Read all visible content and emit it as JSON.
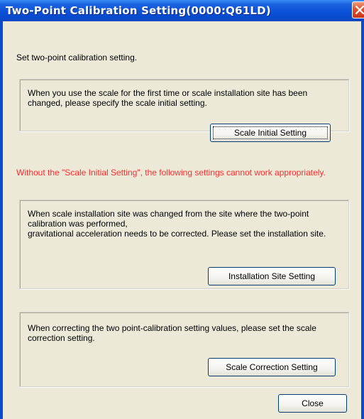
{
  "window": {
    "title": "Two-Point Calibration Setting(0000:Q61LD)"
  },
  "intro": "Set two-point calibration setting.",
  "group1": {
    "text": "When you use the scale for the first time or scale installation site has been changed, please specify the scale initial setting.",
    "button": {
      "label": "Scale Initial Setting",
      "mnemonic": "I"
    }
  },
  "warning": "Without the \"Scale Initial Setting\", the following settings cannot work appropriately.",
  "group2": {
    "text": "When scale installation site was changed from the site where the two-point calibration was performed,\ngravitational acceleration needs to be corrected. Please set the installation site.",
    "button": {
      "label": "Installation Site Setting",
      "mnemonic": "a"
    }
  },
  "group3": {
    "text": "When correcting the two point-calibration setting values, please set the scale correction setting.",
    "button": {
      "label": "Scale Correction Setting",
      "mnemonic": "S"
    }
  },
  "close_button": {
    "label": "Close"
  },
  "colors": {
    "title_bar": "#0a4fd6",
    "dialog_bg": "#ece9d8",
    "warning_text": "#ff2a2a"
  }
}
